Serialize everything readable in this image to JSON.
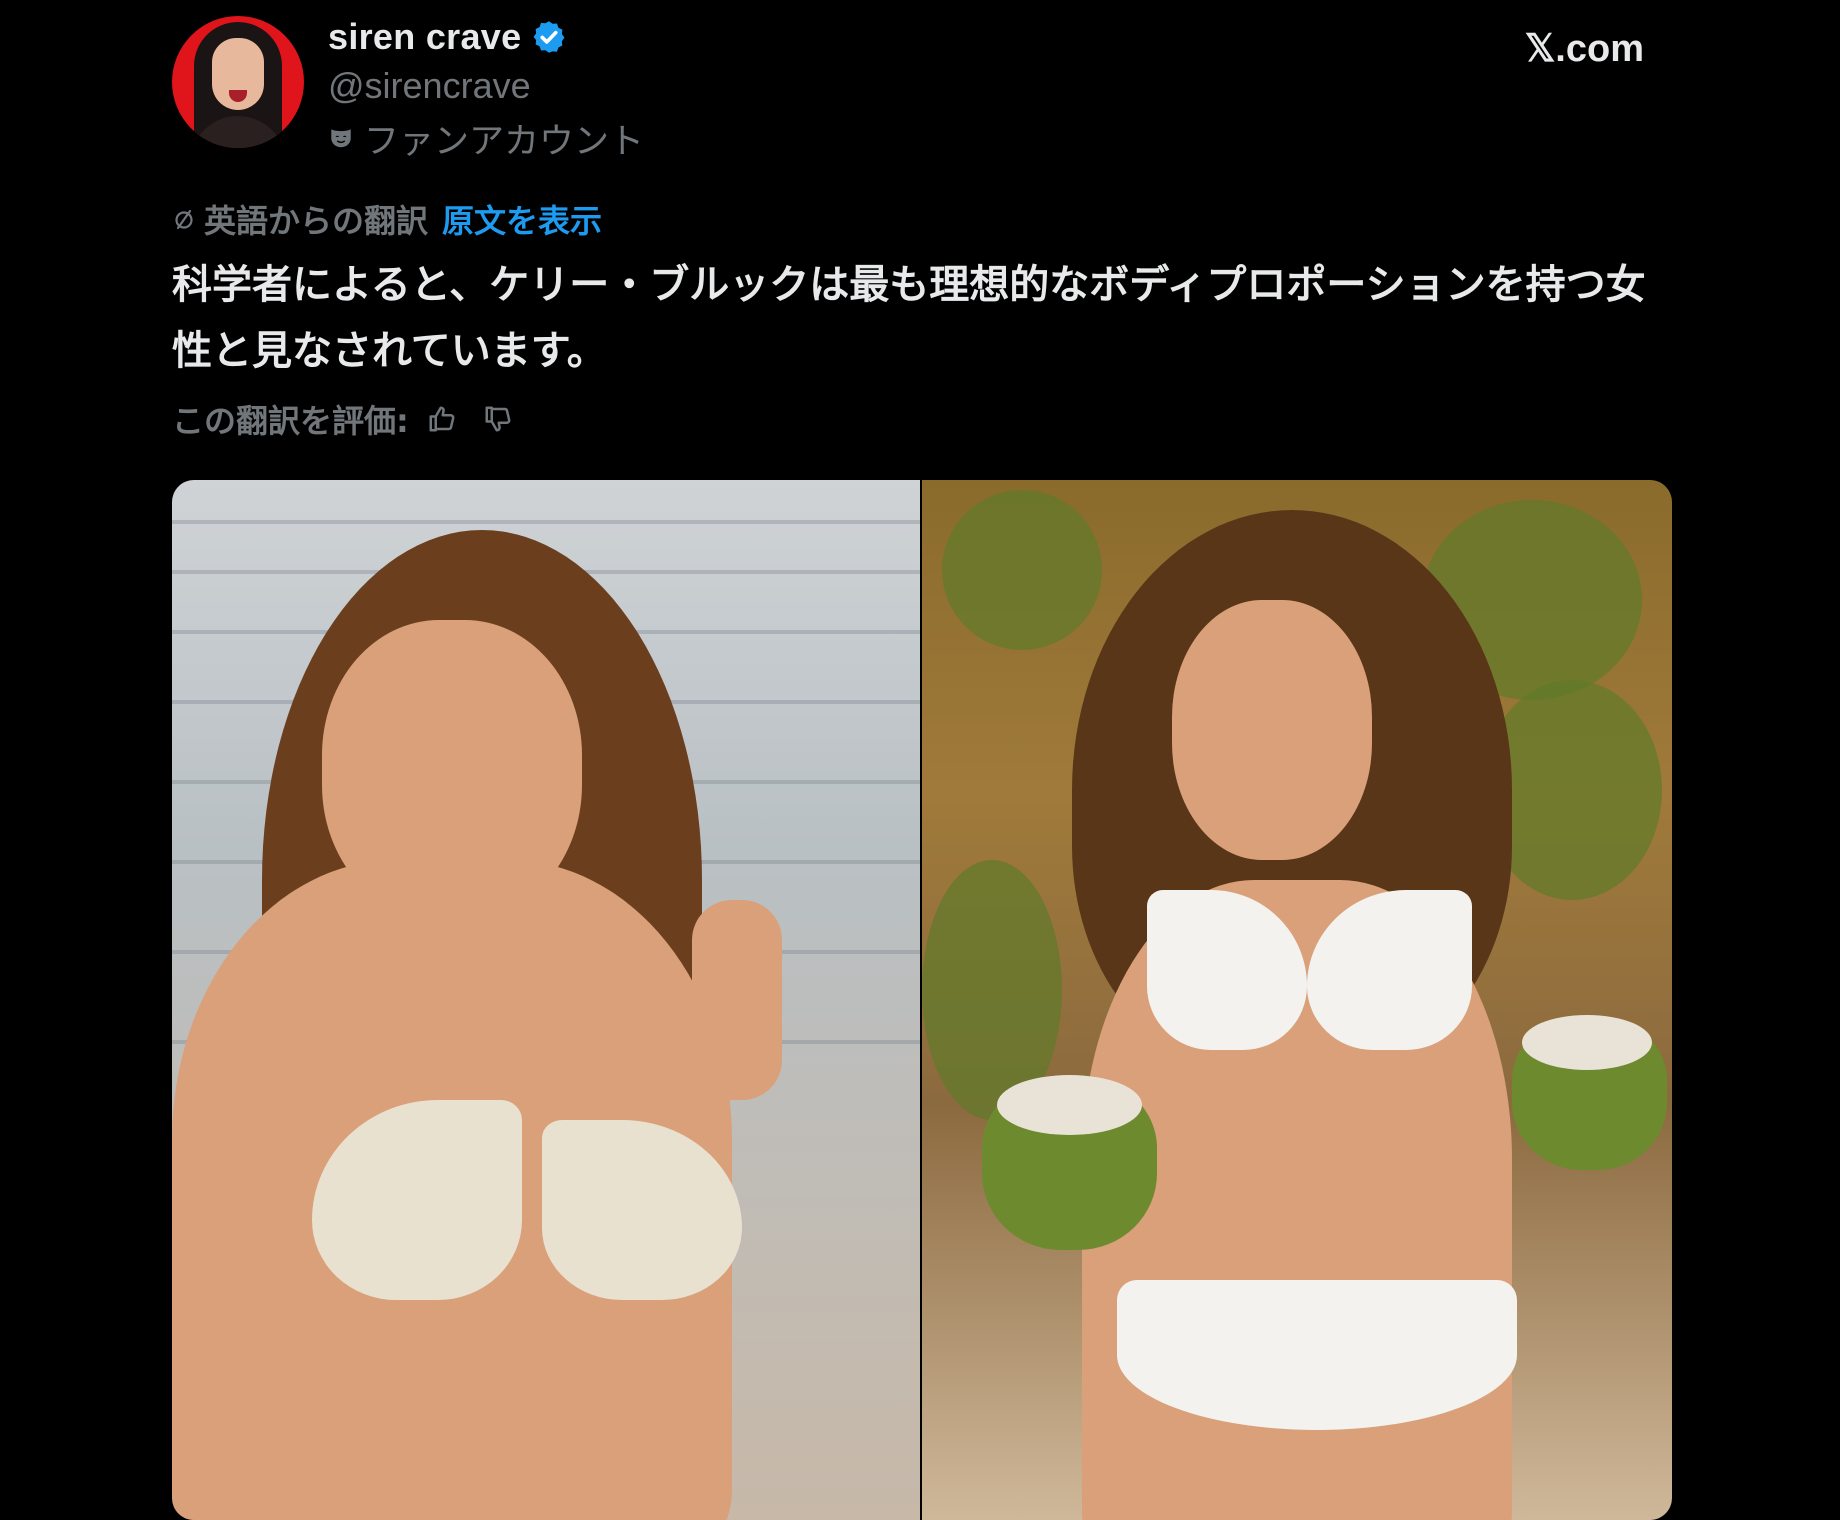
{
  "site": {
    "logo_text": "𝕏.com"
  },
  "author": {
    "display_name": "siren crave",
    "handle": "@sirencrave",
    "account_label": "ファンアカウント",
    "verified": true,
    "verified_color": "#1d9bf0"
  },
  "translation": {
    "translated_from": "英語からの翻訳",
    "show_original": "原文を表示",
    "rate_label": "この翻訳を評価:"
  },
  "post": {
    "text": "科学者によると、ケリー・ブルックは最も理想的なボディプロポーションを持つ女性と見なされています。"
  },
  "colors": {
    "background": "#000000",
    "text_primary": "#e7e9ea",
    "text_secondary": "#71767b",
    "link": "#1d9bf0"
  },
  "icons": {
    "verified": "verified-badge-icon",
    "fan_account": "mask-icon",
    "translate": "translate-icon",
    "thumbs_up": "thumbs-up-icon",
    "thumbs_down": "thumbs-down-icon"
  }
}
